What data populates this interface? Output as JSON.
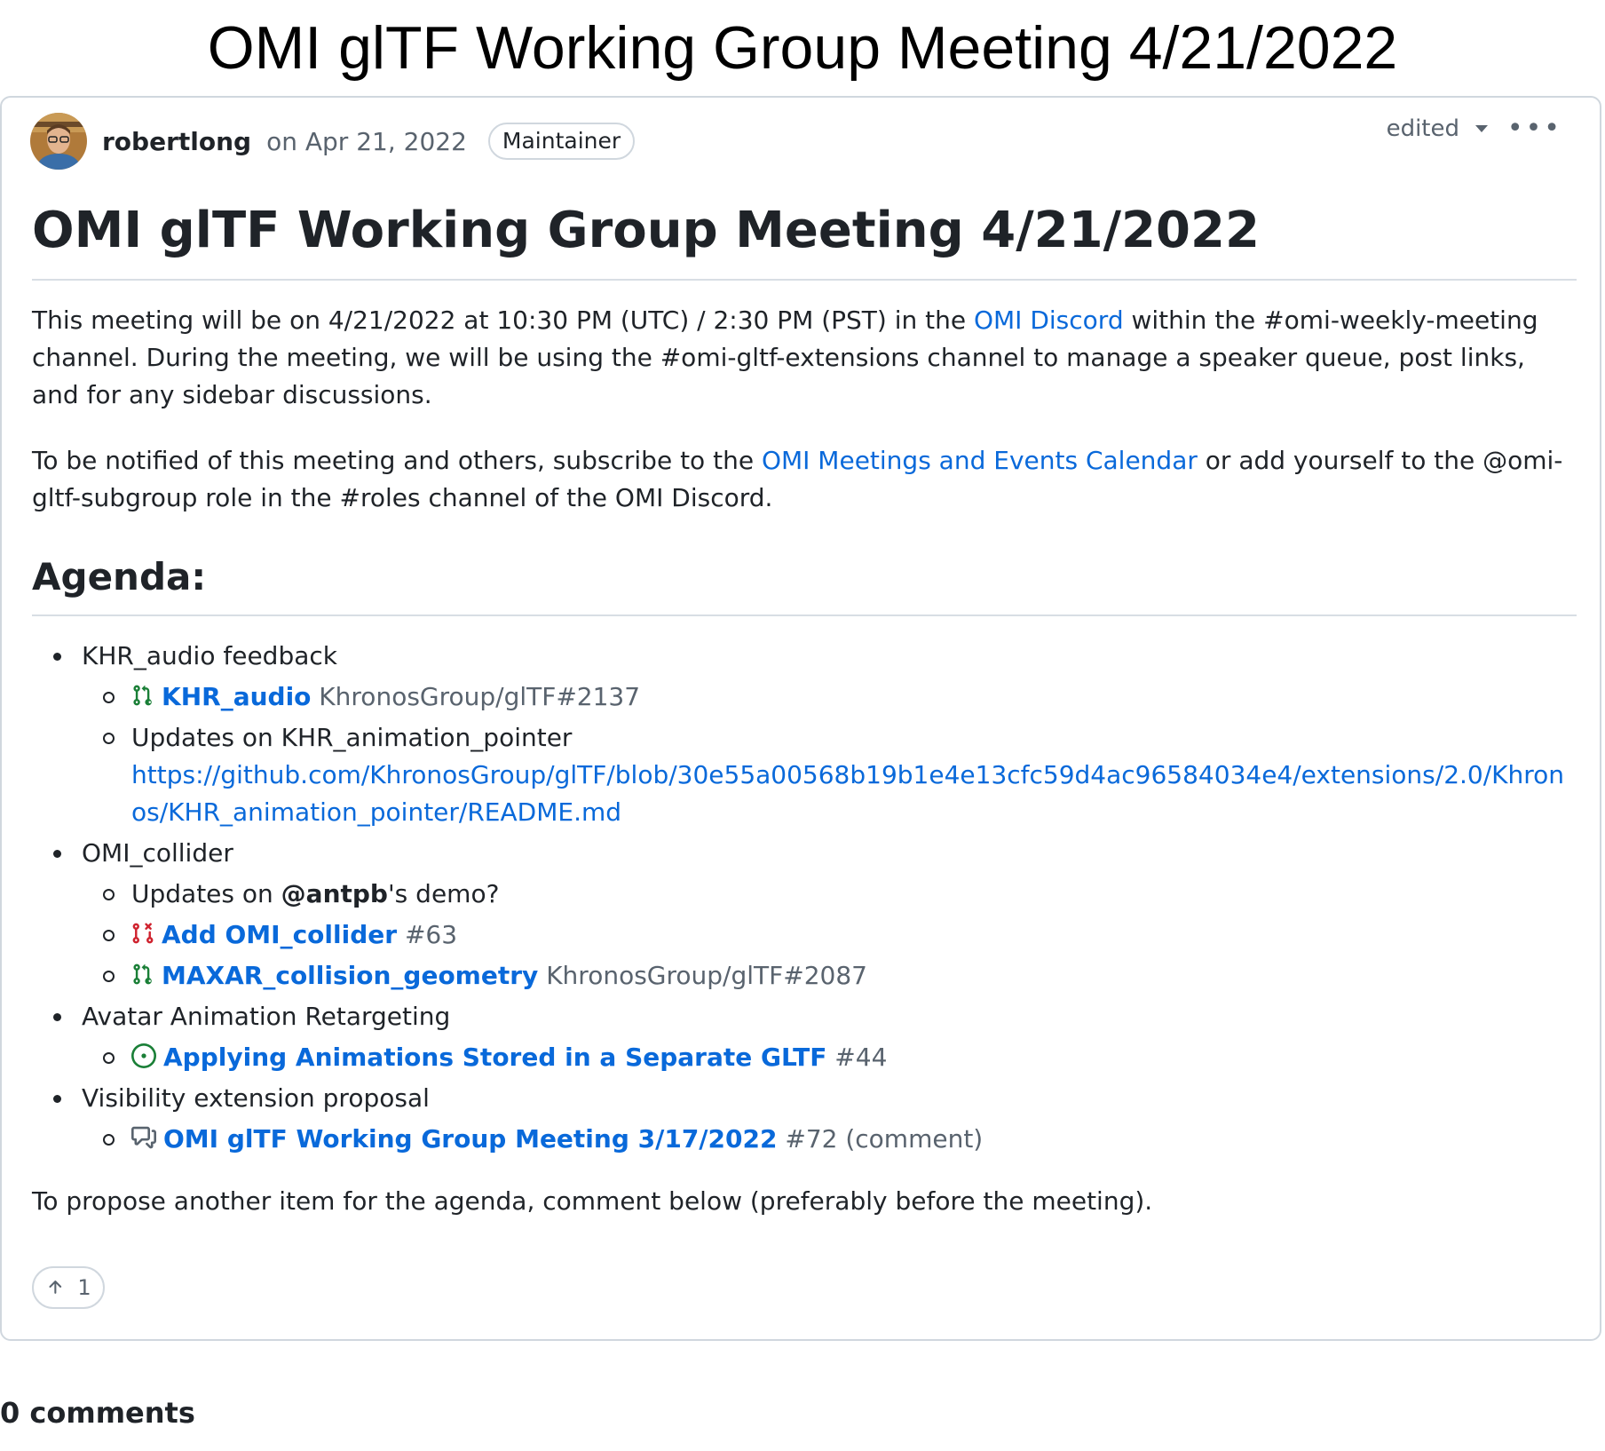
{
  "page_title": "OMI glTF Working Group Meeting 4/21/2022",
  "post": {
    "author": "robertlong",
    "date": "on Apr 21, 2022",
    "badge": "Maintainer",
    "edited_label": "edited",
    "more_label": "•••",
    "heading": "OMI glTF Working Group Meeting 4/21/2022",
    "para1": {
      "before": "This meeting will be on 4/21/2022 at 10:30 PM (UTC) / 2:30 PM (PST) in the ",
      "link": "OMI Discord",
      "after": " within the #omi-weekly-meeting channel. During the meeting, we will be using the #omi-gltf-extensions channel to manage a speaker queue, post links, and for any sidebar discussions."
    },
    "para2": {
      "before": "To be notified of this meeting and others, subscribe to the ",
      "link": "OMI Meetings and Events Calendar",
      "after": " or add yourself to the @omi-gltf-subgroup role in the #roles channel of the OMI Discord."
    },
    "agenda_heading": "Agenda:",
    "agenda": {
      "item1": {
        "label": "KHR_audio feedback",
        "sub1": {
          "title": "KHR_audio",
          "ref": " KhronosGroup/glTF#2137"
        },
        "sub2": {
          "label": "Updates on KHR_animation_pointer",
          "url": "https://github.com/KhronosGroup/glTF/blob/30e55a00568b19b1e4e13cfc59d4ac96584034e4/extensions/2.0/Khronos/KHR_animation_pointer/README.md"
        }
      },
      "item2": {
        "label": "OMI_collider",
        "sub1": {
          "before": "Updates on ",
          "mention": "@antpb",
          "after": "'s demo?"
        },
        "sub2": {
          "title": "Add OMI_collider",
          "ref": " #63"
        },
        "sub3": {
          "title": "MAXAR_collision_geometry",
          "ref": " KhronosGroup/glTF#2087"
        }
      },
      "item3": {
        "label": "Avatar Animation Retargeting",
        "sub1": {
          "title": "Applying Animations Stored in a Separate GLTF",
          "ref": " #44"
        }
      },
      "item4": {
        "label": "Visibility extension proposal",
        "sub1": {
          "title": "OMI glTF Working Group Meeting 3/17/2022",
          "ref": " #72 (comment)"
        }
      }
    },
    "closing": "To propose another item for the agenda, comment below (preferably before the meeting).",
    "reaction": {
      "icon": "arrow-up-icon",
      "count": "1"
    }
  },
  "comments_count": "0 comments",
  "colors": {
    "link": "#0969da",
    "muted": "#59636e",
    "pr_open": "#1a7f37",
    "pr_closed": "#cf222e",
    "border": "#d0d7de"
  }
}
